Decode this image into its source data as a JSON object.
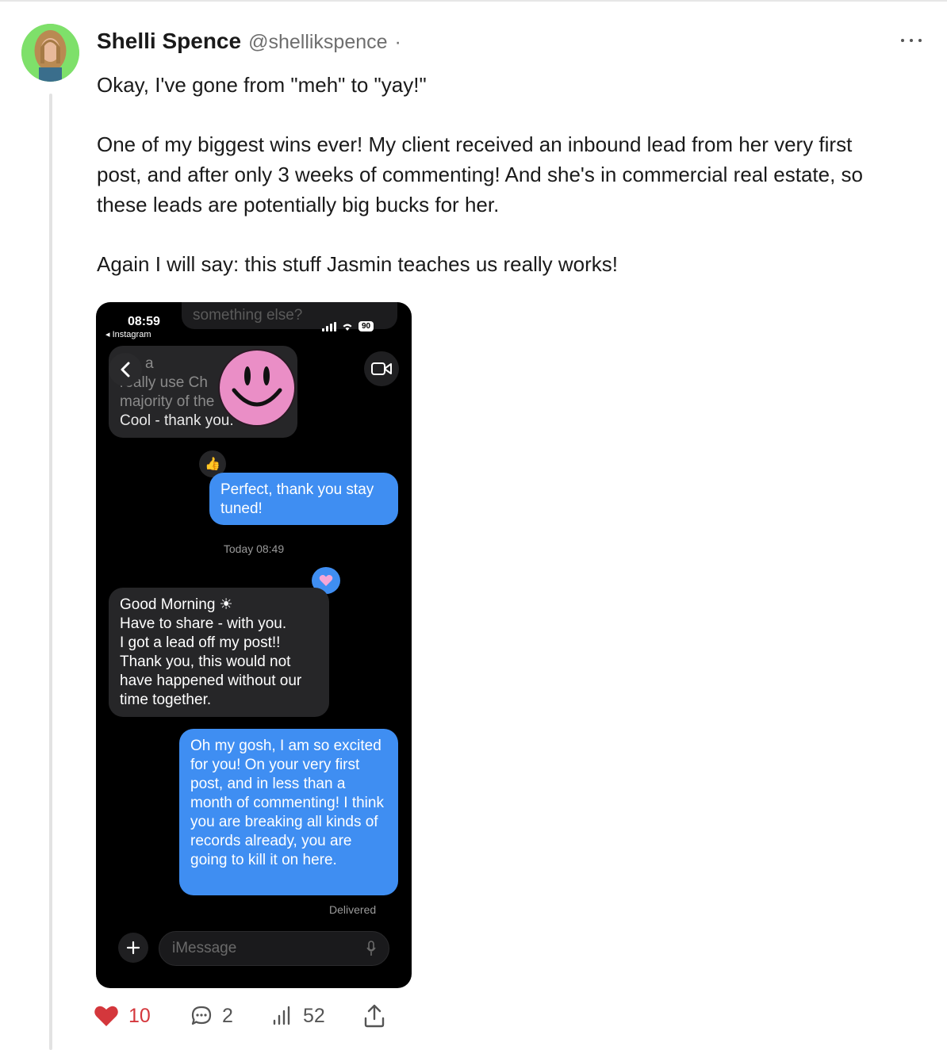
{
  "post": {
    "author_name": "Shelli Spence",
    "author_handle": "@shellikspence",
    "separator": "·",
    "paragraphs": [
      "Okay, I've gone from \"meh\" to \"yay!\"",
      "One of my biggest wins ever! My client received an inbound lead from her very first post, and after only 3 weeks of commenting! And she's in commercial real estate, so these leads are potentially big bucks for her.",
      "Again I will say: this stuff Jasmin teaches us really works!"
    ]
  },
  "screenshot": {
    "status_time": "08:59",
    "status_app": "◂ Instagram",
    "battery": "90",
    "faded_top": "something else?",
    "top_bubble_lines": [
      "a",
      "really use Ch",
      "majority of the",
      "Cool - thank you."
    ],
    "sent_1": "Perfect, thank you stay tuned!",
    "timestamp": "Today 08:49",
    "received_lines": [
      "Good Morning ☀",
      "Have to share - with you.",
      "I got a lead off my post!!",
      "Thank you, this would not",
      "have happened without our",
      "time together."
    ],
    "sent_2": "Oh my gosh, I am so excited for you! On your very first post, and in less than a month of commenting! I think you are breaking all kinds of records already, you are going to kill it on here.",
    "delivered": "Delivered",
    "input_placeholder": "iMessage"
  },
  "actions": {
    "likes": "10",
    "replies": "2",
    "views": "52"
  },
  "icons": {
    "like": "heart-icon",
    "reply": "comment-icon",
    "views": "bar-chart-icon",
    "share": "share-icon",
    "more": "more-dots-icon"
  },
  "colors": {
    "like": "#d4373c",
    "imessage_blue": "#3f8ef2",
    "avatar_bg": "#7ee06a"
  }
}
